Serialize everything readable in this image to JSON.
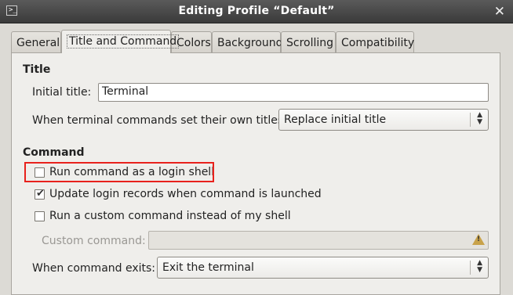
{
  "window": {
    "title": "Editing Profile “Default”",
    "close_glyph": "✕",
    "icon_glyph": ">_"
  },
  "tabs": [
    {
      "label": "General"
    },
    {
      "label": "Title and Command",
      "active": true
    },
    {
      "label": "Colors"
    },
    {
      "label": "Background"
    },
    {
      "label": "Scrolling"
    },
    {
      "label": "Compatibility"
    }
  ],
  "title_section": {
    "heading": "Title",
    "initial_title_label": "Initial title:",
    "initial_title_value": "Terminal",
    "dynamic_title_label": "When terminal commands set their own titles:",
    "dynamic_title_value": "Replace initial title"
  },
  "command_section": {
    "heading": "Command",
    "login_shell_label": "Run command as a login shell",
    "login_shell_checked": false,
    "update_records_label": "Update login records when command is launched",
    "update_records_checked": true,
    "custom_command_check_label": "Run a custom command instead of my shell",
    "custom_command_checked": false,
    "custom_command_label": "Custom command:",
    "custom_command_value": "",
    "exit_label": "When command exits:",
    "exit_value": "Exit the terminal"
  },
  "colors": {
    "highlight": "#e8211c",
    "titlebar": "#3a3a3a"
  }
}
